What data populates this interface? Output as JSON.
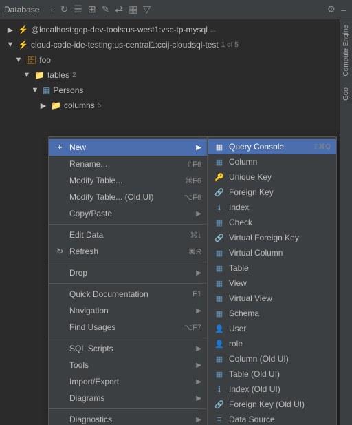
{
  "toolbar": {
    "title": "Database",
    "icons": [
      "settings-icon",
      "list-icon",
      "filter-icon",
      "gear-icon",
      "minimize-icon"
    ]
  },
  "tree": {
    "items": [
      {
        "label": "localhost:gcp-dev-tools:us-west1:vsc-tp-mysql",
        "indent": 1,
        "icon": "⚡",
        "ellipsis": "..."
      },
      {
        "label": "cloud-code-ide-testing:us-central1:ccij-cloudsql-test",
        "indent": 1,
        "icon": "⚡",
        "badge": "1 of 5"
      },
      {
        "label": "foo",
        "indent": 2,
        "icon": "📁"
      },
      {
        "label": "tables",
        "indent": 3,
        "icon": "📁",
        "badge": "2"
      },
      {
        "label": "Persons",
        "indent": 4,
        "icon": "🗃"
      },
      {
        "label": "columns",
        "indent": 5,
        "icon": "📁",
        "badge": "5"
      }
    ]
  },
  "context_menu": {
    "items": [
      {
        "type": "item",
        "label": "New",
        "icon": "+",
        "shortcut": "",
        "hasArrow": true,
        "active": true
      },
      {
        "type": "item",
        "label": "Rename...",
        "shortcut": "⇧F6",
        "hasArrow": false
      },
      {
        "type": "item",
        "label": "Modify Table...",
        "shortcut": "⌘F6",
        "hasArrow": false
      },
      {
        "type": "item",
        "label": "Modify Table... (Old UI)",
        "shortcut": "⌥F6",
        "hasArrow": false
      },
      {
        "type": "item",
        "label": "Copy/Paste",
        "shortcut": "",
        "hasArrow": true
      },
      {
        "type": "separator"
      },
      {
        "type": "item",
        "label": "Edit Data",
        "shortcut": "⌘↓",
        "hasArrow": false
      },
      {
        "type": "item",
        "label": "Refresh",
        "shortcut": "⌘R",
        "hasArrow": false
      },
      {
        "type": "separator"
      },
      {
        "type": "item",
        "label": "Drop",
        "shortcut": "",
        "hasArrow": true
      },
      {
        "type": "separator"
      },
      {
        "type": "item",
        "label": "Quick Documentation",
        "shortcut": "F1",
        "hasArrow": false
      },
      {
        "type": "item",
        "label": "Navigation",
        "shortcut": "",
        "hasArrow": true
      },
      {
        "type": "item",
        "label": "Find Usages",
        "shortcut": "⌥F7",
        "hasArrow": false
      },
      {
        "type": "separator"
      },
      {
        "type": "item",
        "label": "SQL Scripts",
        "shortcut": "",
        "hasArrow": true
      },
      {
        "type": "item",
        "label": "Tools",
        "shortcut": "",
        "hasArrow": true
      },
      {
        "type": "item",
        "label": "Import/Export",
        "shortcut": "",
        "hasArrow": true
      },
      {
        "type": "item",
        "label": "Diagrams",
        "shortcut": "",
        "hasArrow": true
      },
      {
        "type": "separator"
      },
      {
        "type": "item",
        "label": "Diagnostics",
        "shortcut": "",
        "hasArrow": true
      }
    ]
  },
  "submenu": {
    "header": {
      "label": "Query Console",
      "shortcut": "⇧⌘Q"
    },
    "items": [
      {
        "label": "Column",
        "icon": "col"
      },
      {
        "label": "Unique Key",
        "icon": "key"
      },
      {
        "label": "Foreign Key",
        "icon": "fkey"
      },
      {
        "label": "Index",
        "icon": "idx"
      },
      {
        "label": "Check",
        "icon": "chk"
      },
      {
        "label": "Virtual Foreign Key",
        "icon": "vfkey"
      },
      {
        "label": "Virtual Column",
        "icon": "vcol"
      },
      {
        "label": "Table",
        "icon": "tbl"
      },
      {
        "label": "View",
        "icon": "view"
      },
      {
        "label": "Virtual View",
        "icon": "vview"
      },
      {
        "label": "Schema",
        "icon": "schema"
      },
      {
        "label": "User",
        "icon": "user"
      },
      {
        "label": "role",
        "icon": "role"
      },
      {
        "label": "Column (Old UI)",
        "icon": "col"
      },
      {
        "label": "Table (Old UI)",
        "icon": "tbl"
      },
      {
        "label": "Index (Old UI)",
        "icon": "idx"
      },
      {
        "label": "Foreign Key (Old UI)",
        "icon": "fkey"
      },
      {
        "label": "Data Source",
        "icon": "ds"
      }
    ]
  },
  "right_sidebar": {
    "tabs": [
      "Compute Engine",
      "Goo"
    ]
  }
}
